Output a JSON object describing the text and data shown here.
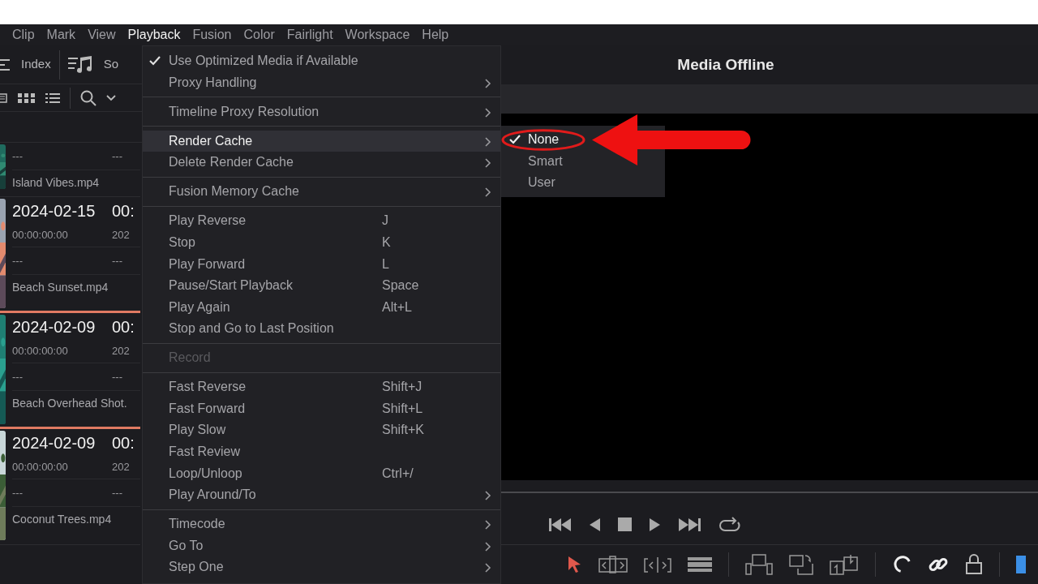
{
  "menu_bar": [
    {
      "label": "Clip",
      "selected": false
    },
    {
      "label": "Mark",
      "selected": false
    },
    {
      "label": "View",
      "selected": false
    },
    {
      "label": "Playback",
      "selected": true
    },
    {
      "label": "Fusion",
      "selected": false
    },
    {
      "label": "Color",
      "selected": false
    },
    {
      "label": "Fairlight",
      "selected": false
    },
    {
      "label": "Workspace",
      "selected": false
    },
    {
      "label": "Help",
      "selected": false
    }
  ],
  "media_pool": {
    "toolbar": [
      {
        "kind": "index",
        "label": "Index"
      },
      {
        "kind": "sound",
        "label": "So"
      }
    ],
    "clips": [
      {
        "dash_1": "---",
        "dash_2": "---",
        "name": "Island Vibes.mp4",
        "selected": false
      },
      {
        "date": "2024-02-15",
        "time": "00:",
        "timecode": "00:00:00:00",
        "date_2": "202",
        "dash_1": "---",
        "dash_2": "---",
        "name": "Beach Sunset.mp4",
        "selected": true
      },
      {
        "date": "2024-02-09",
        "time": "00:",
        "timecode": "00:00:00:00",
        "date_2": "202",
        "dash_1": "---",
        "dash_2": "---",
        "name": "Beach Overhead Shot.",
        "selected": true
      },
      {
        "date": "2024-02-09",
        "time": "00:",
        "timecode": "00:00:00:00",
        "date_2": "202",
        "dash_1": "---",
        "dash_2": "---",
        "name": "Coconut Trees.mp4",
        "selected": false
      }
    ]
  },
  "viewer": {
    "title": "Media Offline"
  },
  "playback_menu": [
    [
      {
        "label": "Use Optimized Media if Available",
        "checked": true,
        "submenu": false,
        "disabled": false,
        "highlighted": false
      },
      {
        "label": "Proxy Handling",
        "checked": false,
        "submenu": true,
        "disabled": false,
        "highlighted": false
      }
    ],
    [
      {
        "label": "Timeline Proxy Resolution",
        "checked": false,
        "submenu": true,
        "disabled": false,
        "highlighted": false
      }
    ],
    [
      {
        "label": "Render Cache",
        "checked": false,
        "submenu": true,
        "disabled": false,
        "highlighted": true
      },
      {
        "label": "Delete Render Cache",
        "checked": false,
        "submenu": true,
        "disabled": false,
        "highlighted": false
      }
    ],
    [
      {
        "label": "Fusion Memory Cache",
        "checked": false,
        "submenu": true,
        "disabled": false,
        "highlighted": false
      }
    ],
    [
      {
        "label": "Play Reverse",
        "shortcut": "J",
        "checked": false,
        "submenu": false,
        "disabled": false,
        "highlighted": false
      },
      {
        "label": "Stop",
        "shortcut": "K",
        "checked": false,
        "submenu": false,
        "disabled": false,
        "highlighted": false
      },
      {
        "label": "Play Forward",
        "shortcut": "L",
        "checked": false,
        "submenu": false,
        "disabled": false,
        "highlighted": false
      },
      {
        "label": "Pause/Start Playback",
        "shortcut": "Space",
        "checked": false,
        "submenu": false,
        "disabled": false,
        "highlighted": false
      },
      {
        "label": "Play Again",
        "shortcut": "Alt+L",
        "checked": false,
        "submenu": false,
        "disabled": false,
        "highlighted": false
      },
      {
        "label": "Stop and Go to Last Position",
        "checked": false,
        "submenu": false,
        "disabled": false,
        "highlighted": false
      }
    ],
    [
      {
        "label": "Record",
        "checked": false,
        "submenu": false,
        "disabled": true,
        "highlighted": false
      }
    ],
    [
      {
        "label": "Fast Reverse",
        "shortcut": "Shift+J",
        "checked": false,
        "submenu": false,
        "disabled": false,
        "highlighted": false
      },
      {
        "label": "Fast Forward",
        "shortcut": "Shift+L",
        "checked": false,
        "submenu": false,
        "disabled": false,
        "highlighted": false
      },
      {
        "label": "Play Slow",
        "shortcut": "Shift+K",
        "checked": false,
        "submenu": false,
        "disabled": false,
        "highlighted": false
      },
      {
        "label": "Fast Review",
        "checked": false,
        "submenu": false,
        "disabled": false,
        "highlighted": false
      },
      {
        "label": "Loop/Unloop",
        "shortcut": "Ctrl+/",
        "checked": false,
        "submenu": false,
        "disabled": false,
        "highlighted": false
      },
      {
        "label": "Play Around/To",
        "checked": false,
        "submenu": true,
        "disabled": false,
        "highlighted": false
      }
    ],
    [
      {
        "label": "Timecode",
        "checked": false,
        "submenu": true,
        "disabled": false,
        "highlighted": false
      },
      {
        "label": "Go To",
        "checked": false,
        "submenu": true,
        "disabled": false,
        "highlighted": false
      },
      {
        "label": "Step One",
        "checked": false,
        "submenu": true,
        "disabled": false,
        "highlighted": false
      }
    ]
  ],
  "render_cache_submenu": [
    {
      "label": "None",
      "checked": true
    },
    {
      "label": "Smart",
      "checked": false
    },
    {
      "label": "User",
      "checked": false
    }
  ]
}
